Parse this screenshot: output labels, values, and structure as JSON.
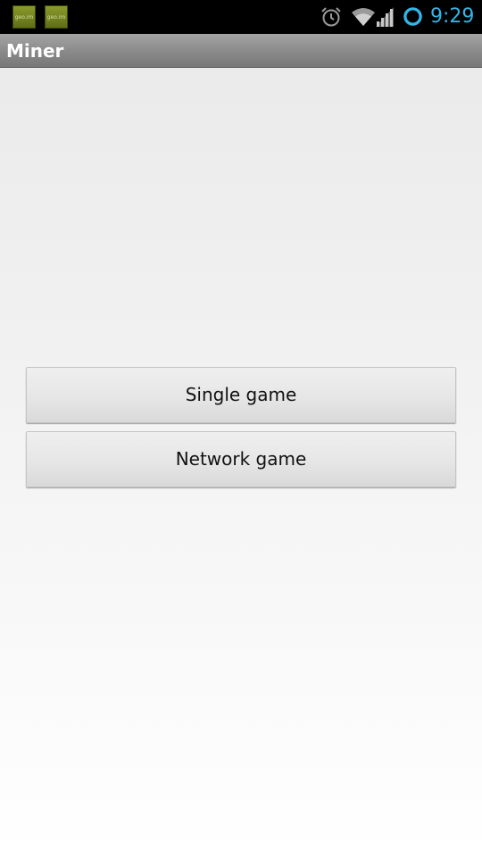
{
  "status_bar": {
    "notification_icons": [
      {
        "icon": "app-notification-icon",
        "label": "geo.im"
      },
      {
        "icon": "app-notification-icon",
        "label": "geo.im"
      }
    ],
    "icons": [
      "alarm-icon",
      "wifi-icon",
      "signal-icon",
      "sync-icon"
    ],
    "time": "9:29",
    "accent_color": "#33b5e5"
  },
  "action_bar": {
    "title": "Miner"
  },
  "main": {
    "buttons": [
      {
        "label": "Single game"
      },
      {
        "label": "Network game"
      }
    ]
  }
}
